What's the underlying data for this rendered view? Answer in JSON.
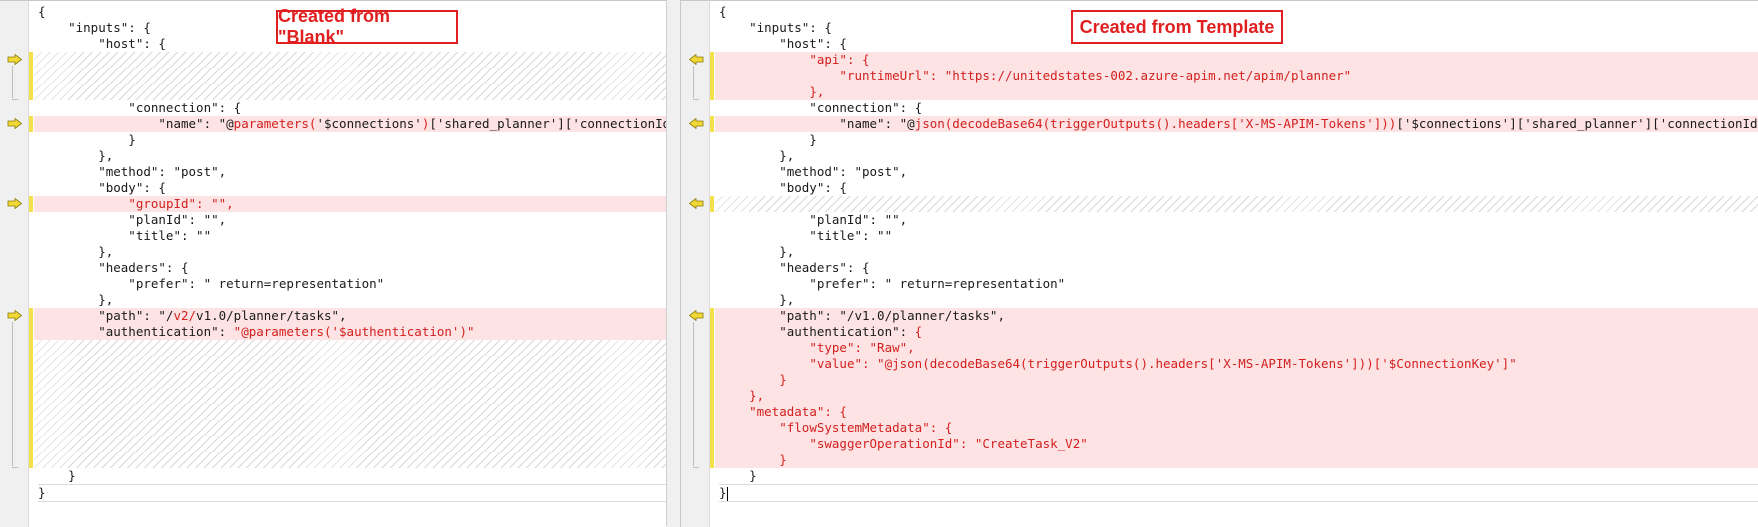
{
  "left_pane": {
    "title": "Created from \"Blank\"",
    "lines": [
      {
        "state": "same",
        "parts": [
          {
            "t": "{"
          }
        ]
      },
      {
        "state": "same",
        "parts": [
          {
            "t": "    \"inputs\": {"
          }
        ]
      },
      {
        "state": "same",
        "parts": [
          {
            "t": "        \"host\": {"
          }
        ]
      },
      {
        "state": "miss",
        "parts": []
      },
      {
        "state": "miss",
        "parts": []
      },
      {
        "state": "miss",
        "parts": []
      },
      {
        "state": "same",
        "parts": [
          {
            "t": "            \"connection\": {"
          }
        ]
      },
      {
        "state": "chg",
        "parts": [
          {
            "t": "                \"name\": \"@"
          },
          {
            "t": "parameters(",
            "red": true
          },
          {
            "t": "'$connections'"
          },
          {
            "t": ")",
            "red": true
          },
          {
            "t": "['shared_planner']['connectionId']\""
          }
        ]
      },
      {
        "state": "same",
        "parts": [
          {
            "t": "            }"
          }
        ]
      },
      {
        "state": "same",
        "parts": [
          {
            "t": "        },"
          }
        ]
      },
      {
        "state": "same",
        "parts": [
          {
            "t": "        \"method\": \"post\","
          }
        ]
      },
      {
        "state": "same",
        "parts": [
          {
            "t": "        \"body\": {"
          }
        ]
      },
      {
        "state": "chg",
        "parts": [
          {
            "t": "            "
          },
          {
            "t": "\"groupId\": \"\",",
            "red": true
          }
        ]
      },
      {
        "state": "same",
        "parts": [
          {
            "t": "            \"planId\": \"\","
          }
        ]
      },
      {
        "state": "same",
        "parts": [
          {
            "t": "            \"title\": \"\""
          }
        ]
      },
      {
        "state": "same",
        "parts": [
          {
            "t": "        },"
          }
        ]
      },
      {
        "state": "same",
        "parts": [
          {
            "t": "        \"headers\": {"
          }
        ]
      },
      {
        "state": "same",
        "parts": [
          {
            "t": "            \"prefer\": \" return=representation\""
          }
        ]
      },
      {
        "state": "same",
        "parts": [
          {
            "t": "        },"
          }
        ]
      },
      {
        "state": "chg",
        "parts": [
          {
            "t": "        \"path\": \"/"
          },
          {
            "t": "v2/",
            "red": true
          },
          {
            "t": "v1.0/planner/tasks\","
          }
        ]
      },
      {
        "state": "chg",
        "parts": [
          {
            "t": "        \"authentication\": "
          },
          {
            "t": "\"@parameters('$authentication')\"",
            "red": true
          }
        ]
      },
      {
        "state": "miss",
        "parts": []
      },
      {
        "state": "miss",
        "parts": []
      },
      {
        "state": "miss",
        "parts": []
      },
      {
        "state": "miss",
        "parts": []
      },
      {
        "state": "miss",
        "parts": []
      },
      {
        "state": "miss",
        "parts": []
      },
      {
        "state": "miss",
        "parts": []
      },
      {
        "state": "miss",
        "parts": []
      },
      {
        "state": "same",
        "parts": [
          {
            "t": "    }"
          }
        ]
      },
      {
        "state": "last",
        "parts": [
          {
            "t": "}"
          }
        ]
      }
    ]
  },
  "right_pane": {
    "title": "Created from Template",
    "lines": [
      {
        "state": "same",
        "parts": [
          {
            "t": "{"
          }
        ]
      },
      {
        "state": "same",
        "parts": [
          {
            "t": "    \"inputs\": {"
          }
        ]
      },
      {
        "state": "same",
        "parts": [
          {
            "t": "        \"host\": {"
          }
        ]
      },
      {
        "state": "chg",
        "parts": [
          {
            "t": "            "
          },
          {
            "t": "\"api\": {",
            "red": true
          }
        ]
      },
      {
        "state": "chg",
        "parts": [
          {
            "t": "                "
          },
          {
            "t": "\"runtimeUrl\": \"https://unitedstates-002.azure-apim.net/apim/planner\"",
            "red": true
          }
        ]
      },
      {
        "state": "chg",
        "parts": [
          {
            "t": "            "
          },
          {
            "t": "},",
            "red": true
          }
        ]
      },
      {
        "state": "same",
        "parts": [
          {
            "t": "            \"connection\": {"
          }
        ]
      },
      {
        "state": "chg",
        "parts": [
          {
            "t": "                \"name\": \"@"
          },
          {
            "t": "json(decodeBase64(triggerOutputs().headers['X-MS-APIM-Tokens']))",
            "red": true
          },
          {
            "t": "['$connections']['shared_planner']['connectionId']\""
          }
        ]
      },
      {
        "state": "same",
        "parts": [
          {
            "t": "            }"
          }
        ]
      },
      {
        "state": "same",
        "parts": [
          {
            "t": "        },"
          }
        ]
      },
      {
        "state": "same",
        "parts": [
          {
            "t": "        \"method\": \"post\","
          }
        ]
      },
      {
        "state": "same",
        "parts": [
          {
            "t": "        \"body\": {"
          }
        ]
      },
      {
        "state": "miss",
        "parts": []
      },
      {
        "state": "same",
        "parts": [
          {
            "t": "            \"planId\": \"\","
          }
        ]
      },
      {
        "state": "same",
        "parts": [
          {
            "t": "            \"title\": \"\""
          }
        ]
      },
      {
        "state": "same",
        "parts": [
          {
            "t": "        },"
          }
        ]
      },
      {
        "state": "same",
        "parts": [
          {
            "t": "        \"headers\": {"
          }
        ]
      },
      {
        "state": "same",
        "parts": [
          {
            "t": "            \"prefer\": \" return=representation\""
          }
        ]
      },
      {
        "state": "same",
        "parts": [
          {
            "t": "        },"
          }
        ]
      },
      {
        "state": "chg",
        "parts": [
          {
            "t": "        \"path\": \"/v1.0/planner/tasks\","
          }
        ]
      },
      {
        "state": "chg",
        "parts": [
          {
            "t": "        \"authentication\": "
          },
          {
            "t": "{",
            "red": true
          }
        ]
      },
      {
        "state": "chg",
        "parts": [
          {
            "t": "            "
          },
          {
            "t": "\"type\": \"Raw\",",
            "red": true
          }
        ]
      },
      {
        "state": "chg",
        "parts": [
          {
            "t": "            "
          },
          {
            "t": "\"value\": \"@json(decodeBase64(triggerOutputs().headers['X-MS-APIM-Tokens']))['$ConnectionKey']\"",
            "red": true
          }
        ]
      },
      {
        "state": "chg",
        "parts": [
          {
            "t": "        "
          },
          {
            "t": "}",
            "red": true
          }
        ]
      },
      {
        "state": "chg",
        "parts": [
          {
            "t": "    "
          },
          {
            "t": "},",
            "red": true
          }
        ]
      },
      {
        "state": "chg",
        "parts": [
          {
            "t": "    "
          },
          {
            "t": "\"metadata\": {",
            "red": true
          }
        ]
      },
      {
        "state": "chg",
        "parts": [
          {
            "t": "        "
          },
          {
            "t": "\"flowSystemMetadata\": {",
            "red": true
          }
        ]
      },
      {
        "state": "chg",
        "parts": [
          {
            "t": "            "
          },
          {
            "t": "\"swaggerOperationId\": \"CreateTask_V2\"",
            "red": true
          }
        ]
      },
      {
        "state": "chg",
        "parts": [
          {
            "t": "        "
          },
          {
            "t": "}",
            "red": true
          }
        ]
      },
      {
        "state": "same",
        "parts": [
          {
            "t": "    }"
          }
        ]
      },
      {
        "state": "last",
        "parts": [
          {
            "t": "}"
          }
        ],
        "caret": true
      }
    ]
  },
  "colors": {
    "changed_bg": "#fde3e3",
    "changed_text": "#d42020",
    "change_bar": "#f4e04a",
    "title_border": "#e02020",
    "arrow_fill": "#f2d833"
  },
  "icons": {
    "left_marker": "arrow-right-icon",
    "right_marker": "arrow-left-icon"
  }
}
